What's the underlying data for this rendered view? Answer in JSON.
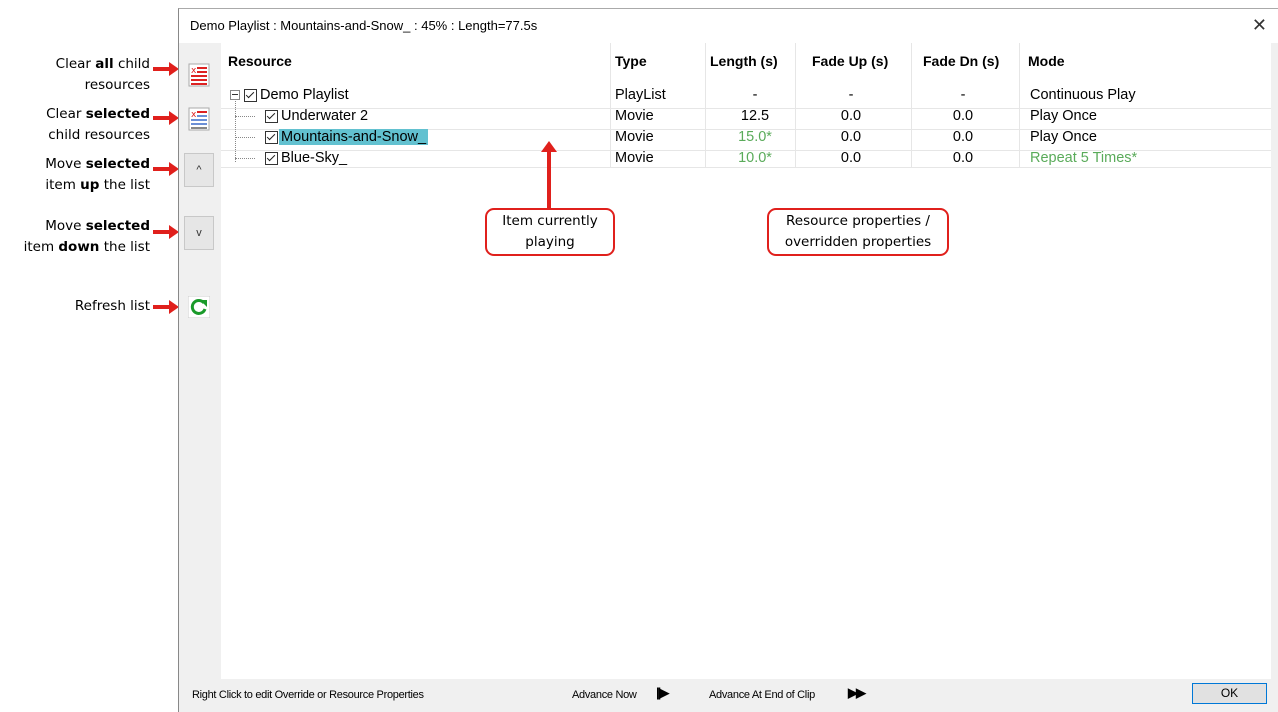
{
  "window": {
    "title": "Demo Playlist : Mountains-and-Snow_ : 45% : Length=77.5s"
  },
  "annotations": {
    "clear_all": {
      "line1_pre": "Clear ",
      "line1_bold": "all",
      "line1_post": " child",
      "line2": "resources"
    },
    "clear_selected": {
      "line1_pre": "Clear ",
      "line1_bold": "selected",
      "line2": "child  resources"
    },
    "move_up": {
      "line1_pre": "Move ",
      "line1_bold": "selected",
      "line2_pre": "item ",
      "line2_bold": "up",
      "line2_post": " the list"
    },
    "move_down": {
      "line1_pre": "Move ",
      "line1_bold": "selected",
      "line2_pre": "item ",
      "line2_bold": "down",
      "line2_post": " the list"
    },
    "refresh": "Refresh list"
  },
  "toolbar": {
    "up_label": "^",
    "down_label": "v"
  },
  "columns": [
    "Resource",
    "Type",
    "Length (s)",
    "Fade Up (s)",
    "Fade Dn (s)",
    "Mode"
  ],
  "rows": [
    {
      "resource": "Demo Playlist",
      "type": "PlayList",
      "length": "-",
      "fade_up": "-",
      "fade_dn": "-",
      "mode": "Continuous Play"
    },
    {
      "resource": "Underwater 2",
      "type": "Movie",
      "length": "12.5",
      "fade_up": "0.0",
      "fade_dn": "0.0",
      "mode": "Play Once"
    },
    {
      "resource": "Mountains-and-Snow_",
      "type": "Movie",
      "length": "15.0*",
      "fade_up": "0.0",
      "fade_dn": "0.0",
      "mode": "Play Once"
    },
    {
      "resource": "Blue-Sky_",
      "type": "Movie",
      "length": "10.0*",
      "fade_up": "0.0",
      "fade_dn": "0.0",
      "mode": "Repeat 5 Times*"
    }
  ],
  "callouts": {
    "playing": {
      "line1": "Item currently",
      "line2": "playing"
    },
    "properties": {
      "line1": "Resource properties /",
      "line2": "overridden properties"
    }
  },
  "status": {
    "hint": "Right Click to edit Override or Resource Properties",
    "advance_now": "Advance Now",
    "advance_end": "Advance At End of Clip",
    "ok": "OK"
  },
  "colors": {
    "accent_red": "#e0201c",
    "override_green": "#5aab5a",
    "selection": "#62c1d0"
  }
}
